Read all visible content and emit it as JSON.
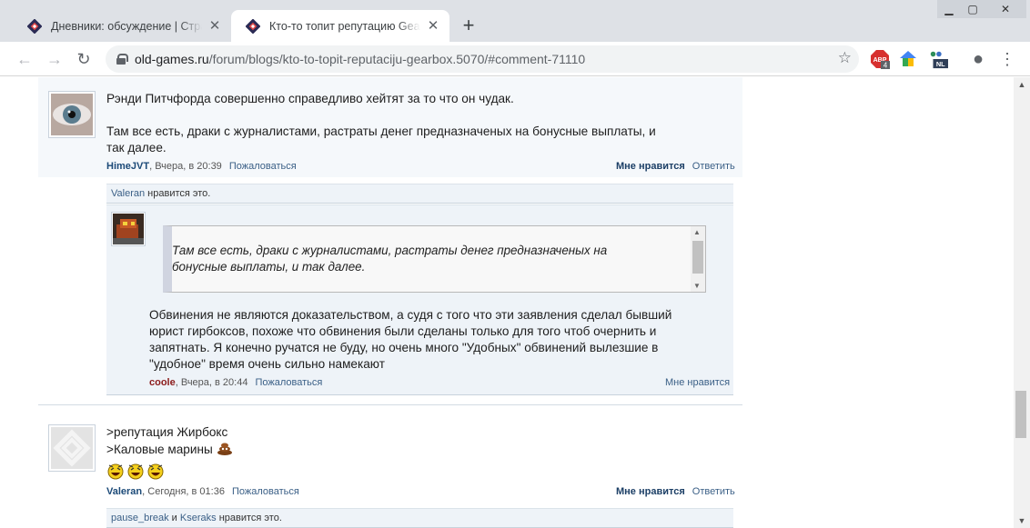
{
  "browser": {
    "tabs": [
      {
        "title": "Дневники: обсуждение | Страница",
        "active": false
      },
      {
        "title": "Кто-то топит репутацию Gearbox",
        "active": true
      }
    ],
    "url_host": "old-games.ru",
    "url_path": "/forum/blogs/kto-to-topit-reputaciju-gearbox.5070/#comment-71110",
    "new_tab_label": "+",
    "ext_badge_abp": "4",
    "ext_badge_nl": "NL"
  },
  "comments": [
    {
      "text_lines": [
        "Рэнди Питчфорда совершенно справедливо хейтят за то что он чудак.",
        "",
        "Там все есть, драки с журналистами, растраты денег предназначеных на бонусные выплаты, и",
        "так далее."
      ],
      "author": "HimeJVT",
      "time": "Вчера, в 20:39",
      "report": "Пожаловаться",
      "like": "Мне нравится",
      "reply": "Ответить",
      "likes_user": "Valeran",
      "likes_suffix": "нравится это."
    },
    {
      "quote_lines": [
        "Там все есть, драки с журналистами, растраты денег предназначеных на",
        "бонусные выплаты, и так далее."
      ],
      "text_lines": [
        "Обвинения не являются доказательством, а судя с того что эти заявления сделал бывший",
        "юрист гирбоксов, похоже что обвинения были сделаны только для того чтоб очернить и",
        "запятнать. Я конечно ручатся не буду, но очень много \"Удобных\" обвинений вылезшие в",
        "\"удобное\" время очень сильно намекают"
      ],
      "author": "coole",
      "time": "Вчера, в 20:44",
      "report": "Пожаловаться",
      "like": "Мне нравится"
    },
    {
      "text_lines": [
        ">репутация Жирбокс",
        ">Каловые марины"
      ],
      "author": "Valeran",
      "time": "Сегодня, в 01:36",
      "report": "Пожаловаться",
      "like": "Мне нравится",
      "reply": "Ответить",
      "likes_user1": "pause_break",
      "likes_and": "и",
      "likes_user2": "Kseraks",
      "likes_suffix": "нравится это."
    }
  ]
}
